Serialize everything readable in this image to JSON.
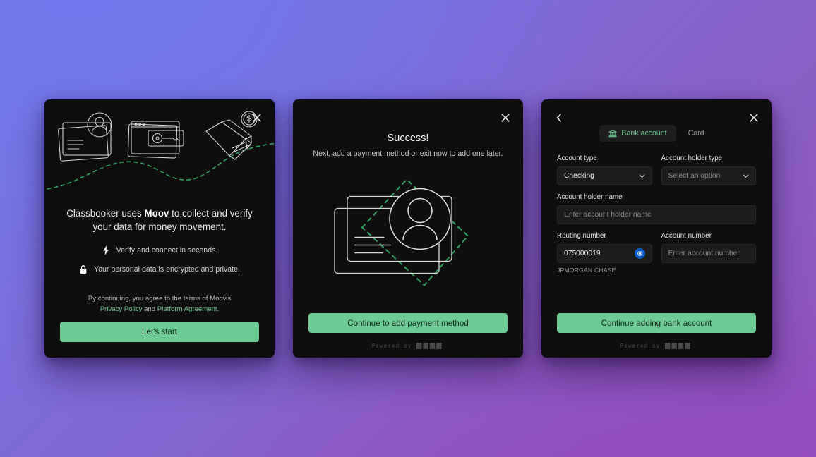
{
  "theme": {
    "accent_green": "#6ecb95",
    "card_bg": "#0e0e0e",
    "bg_gradient_start": "#7579e7",
    "bg_gradient_end": "#9152bb",
    "chase_blue": "#0b5ec9"
  },
  "card1": {
    "close_label": "Close",
    "headline_prefix": "Classbooker uses ",
    "headline_brand": "Moov",
    "headline_suffix": " to collect and verify your data for money movement.",
    "bullets": [
      {
        "icon": "bolt-icon",
        "text": "Verify and connect in seconds."
      },
      {
        "icon": "lock-icon",
        "text": "Your personal data is encrypted and private."
      }
    ],
    "legal_prefix": "By continuing, you agree to the terms of Moov's ",
    "legal_link1": "Privacy Policy",
    "legal_between": " and ",
    "legal_link2": "Platform Agreement",
    "legal_suffix": ".",
    "cta_label": "Let's start"
  },
  "card2": {
    "close_label": "Close",
    "title": "Success!",
    "subtitle": "Next, add a payment method or exit now to add one later.",
    "cta_label": "Continue to add payment method",
    "powered_by": "Powered by",
    "powered_brand": "moov"
  },
  "card3": {
    "close_label": "Close",
    "back_label": "Back",
    "tabs": [
      {
        "id": "bank-account",
        "label": "Bank account",
        "icon": "bank-icon",
        "active": true
      },
      {
        "id": "card",
        "label": "Card",
        "icon": "",
        "active": false
      }
    ],
    "fields": {
      "account_type": {
        "label": "Account type",
        "value": "Checking",
        "is_placeholder": false
      },
      "account_holder_type": {
        "label": "Account holder type",
        "value": "Select an option",
        "is_placeholder": true
      },
      "account_holder_name": {
        "label": "Account holder name",
        "value": "Enter account holder name",
        "is_placeholder": true
      },
      "routing_number": {
        "label": "Routing number",
        "value": "075000019",
        "is_placeholder": false,
        "help": "JPMORGAN CHASE",
        "badge_icon": "chase-bank-icon"
      },
      "account_number": {
        "label": "Account number",
        "value": "Enter account number",
        "is_placeholder": true
      }
    },
    "cta_label": "Continue adding bank account",
    "powered_by": "Powered by",
    "powered_brand": "moov"
  }
}
